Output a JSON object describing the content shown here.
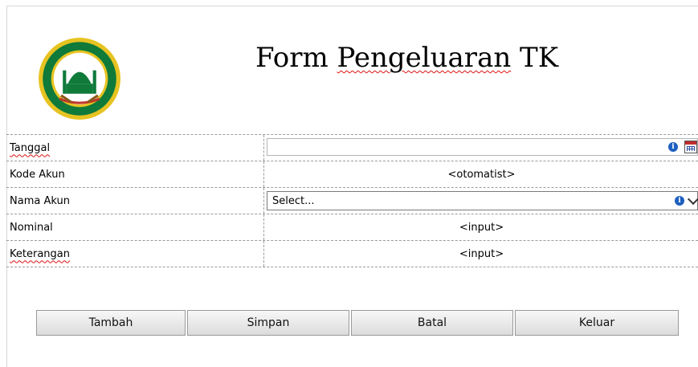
{
  "header": {
    "title_prefix": "Form ",
    "title_word": "Pengeluaran",
    "title_suffix": " TK",
    "logo_icon": "mosque-emblem-icon"
  },
  "form": {
    "rows": [
      {
        "label": "Tanggal",
        "value": ""
      },
      {
        "label": "Kode Akun",
        "value": "<otomatist>"
      },
      {
        "label": "Nama Akun",
        "value": "Select..."
      },
      {
        "label": "Nominal",
        "value": "<input>"
      },
      {
        "label": "Keterangan",
        "value": "<input>"
      }
    ]
  },
  "buttons": {
    "tambah": "Tambah",
    "simpan": "Simpan",
    "batal": "Batal",
    "keluar": "Keluar"
  },
  "colors": {
    "logo_green": "#0f7a3a",
    "logo_gold": "#e7c321",
    "info_blue": "#1d5fbf"
  }
}
